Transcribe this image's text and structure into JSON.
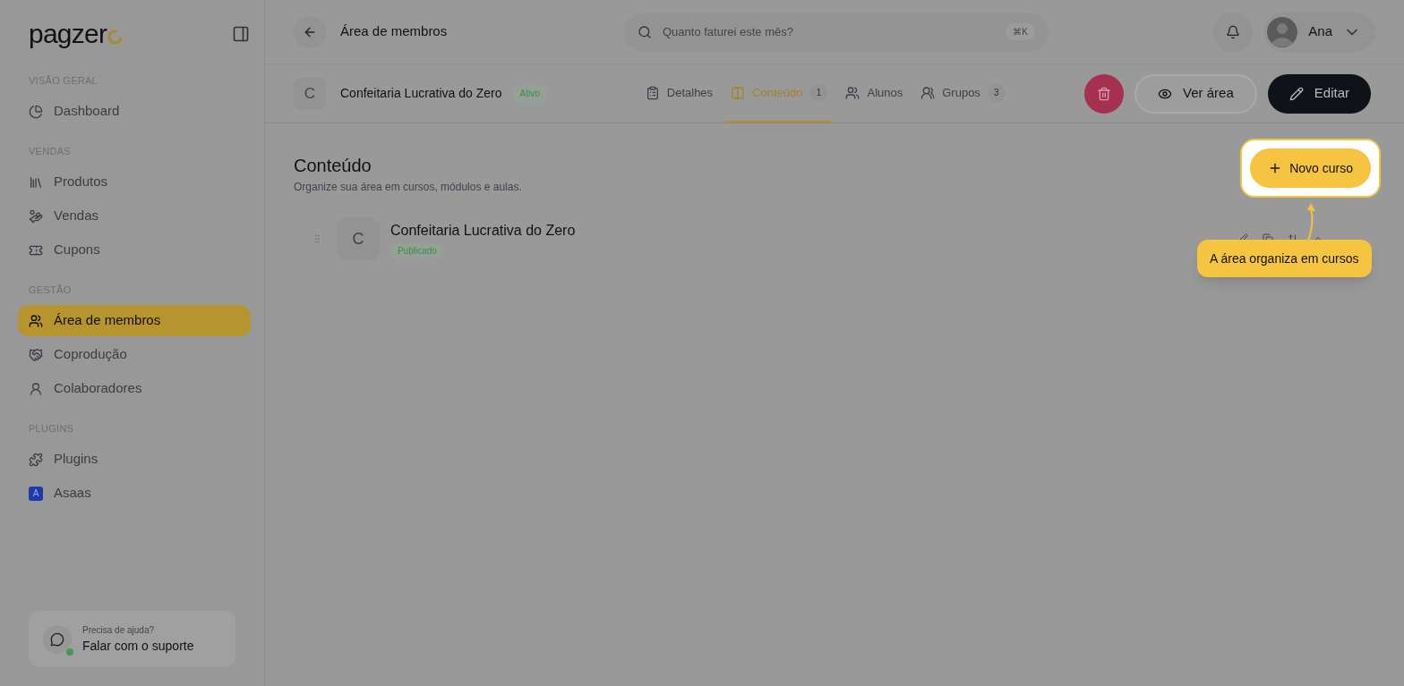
{
  "sidebar": {
    "logo": "pagzer",
    "sections": [
      {
        "label": "VISÃO GERAL",
        "items": [
          {
            "label": "Dashboard",
            "selected": false
          }
        ]
      },
      {
        "label": "VENDAS",
        "items": [
          {
            "label": "Produtos",
            "selected": false
          },
          {
            "label": "Vendas",
            "selected": false
          },
          {
            "label": "Cupons",
            "selected": false
          }
        ]
      },
      {
        "label": "GESTÃO",
        "items": [
          {
            "label": "Área de membros",
            "selected": true
          },
          {
            "label": "Coprodução",
            "selected": false
          },
          {
            "label": "Colaboradores",
            "selected": false
          }
        ]
      },
      {
        "label": "PLUGINS",
        "items": [
          {
            "label": "Plugins",
            "selected": false
          },
          {
            "label": "Asaas",
            "letter": "A",
            "selected": false
          }
        ]
      }
    ],
    "help": {
      "subtitle": "Precisa de ajuda?",
      "title": "Falar com o suporte"
    }
  },
  "header": {
    "title": "Área de membros",
    "search": {
      "placeholder": "Quanto faturei este mês?",
      "shortcut": "⌘K"
    },
    "user": "Ana"
  },
  "area": {
    "letter": "C",
    "name": "Confeitaria Lucrativa do Zero",
    "status": "Ativo",
    "tabs": [
      {
        "label": "Detalhes",
        "selected": false
      },
      {
        "label": "Conteúdo",
        "count": "1",
        "selected": true
      },
      {
        "label": "Alunos",
        "selected": false
      },
      {
        "label": "Grupos",
        "count": "3",
        "selected": false
      }
    ],
    "view_button": "Ver área",
    "edit_button": "Editar"
  },
  "content": {
    "title": "Conteúdo",
    "subtitle": "Organize sua área em cursos, módulos e aulas.",
    "new_button": "Novo curso",
    "courses": [
      {
        "letter": "C",
        "title": "Confeitaria Lucrativa do Zero",
        "status": "Publicado"
      }
    ],
    "tooltip": "A área organiza em cursos"
  }
}
